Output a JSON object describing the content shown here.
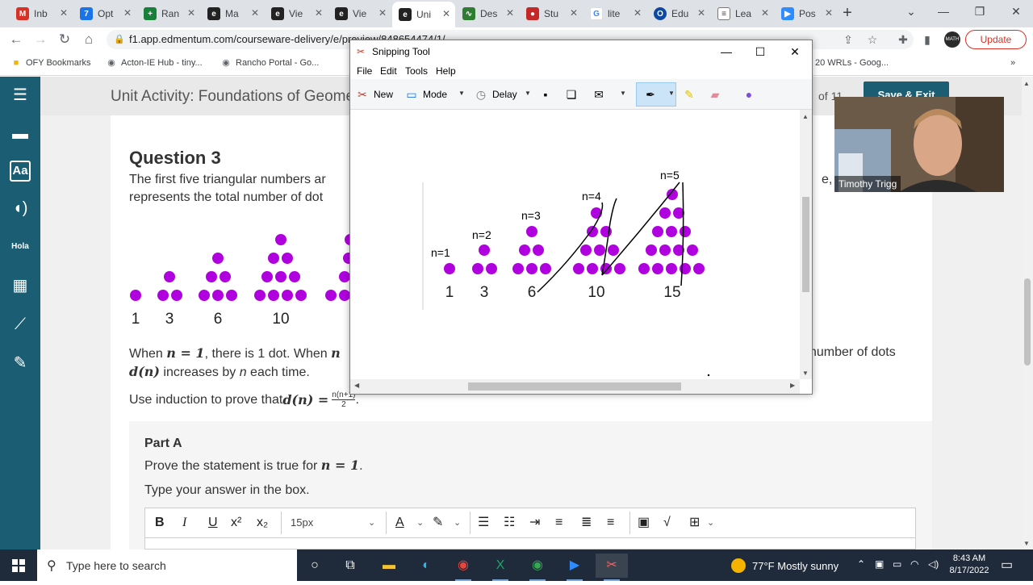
{
  "browser": {
    "tabs": [
      {
        "label": "Inb",
        "icon": "gmail-icon",
        "color": "#d93025"
      },
      {
        "label": "Opt",
        "icon": "calendar-icon",
        "color": "#1a73e8"
      },
      {
        "label": "Ran",
        "icon": "sheets-icon",
        "color": "#188038"
      },
      {
        "label": "Ma",
        "icon": "edmentum-icon",
        "color": "#222222"
      },
      {
        "label": "Vie",
        "icon": "edmentum-icon",
        "color": "#222222"
      },
      {
        "label": "Vie",
        "icon": "edmentum-icon",
        "color": "#222222"
      },
      {
        "label": "Uni",
        "icon": "edmentum-icon",
        "color": "#222222"
      },
      {
        "label": "Des",
        "icon": "desmos-icon",
        "color": "#2e7d32"
      },
      {
        "label": "Stu",
        "icon": "apple-icon",
        "color": "#c62828"
      },
      {
        "label": "lite",
        "icon": "google-icon",
        "color": "#4285f4"
      },
      {
        "label": "Edu",
        "icon": "edu-icon",
        "color": "#0d47a1"
      },
      {
        "label": "Lea",
        "icon": "doc-icon",
        "color": "#3c4043"
      },
      {
        "label": "Pos",
        "icon": "zoom-icon",
        "color": "#2d8cff"
      }
    ],
    "url": "f1.app.edmentum.com/courseware-delivery/e/preview/848654474/1/",
    "update_label": "Update",
    "avatar_text": "MATH",
    "bookmarks": [
      "OFY Bookmarks",
      "Acton-IE Hub - tiny...",
      "Rancho Portal - Go...",
      "20 WRLs - Goog..."
    ]
  },
  "page": {
    "title": "Unit Activity: Foundations of Geome",
    "count": "of  11",
    "save_exit": "Save & Exit",
    "question_title": "Question 3",
    "intro_line1": "The first five triangular numbers ar",
    "intro_line1_right": "e, ar",
    "intro_line2": "represents the total number of dot",
    "dot_labels": [
      "1",
      "3",
      "6",
      "10"
    ],
    "when_text_a": "When ",
    "when_math_a": "n = 1",
    "when_text_b": ", there is 1 dot. When ",
    "when_math_b": "n",
    "when_right": "number of dots",
    "increase_math": "d(n)",
    "increase_text": " increases by ",
    "increase_n": "n",
    "increase_tail": " each time.",
    "induction_text": "Use induction to prove that ",
    "induction_math": "d(n) =",
    "fraction_num": "n(n+1)",
    "fraction_den": "2",
    "part_a_title": "Part A",
    "part_a_text": "Prove the statement is true for ",
    "part_a_math": "n = 1",
    "part_a_hint": "Type your answer in the box.",
    "editor": {
      "font_size": "15px",
      "buttons": [
        "B",
        "I",
        "U",
        "x²",
        "x₂"
      ]
    }
  },
  "snipping_tool": {
    "title": "Snipping Tool",
    "menu": [
      "File",
      "Edit",
      "Tools",
      "Help"
    ],
    "tools": {
      "new": "New",
      "mode": "Mode",
      "delay": "Delay"
    },
    "annotations": [
      "n=1",
      "n=2",
      "n=3",
      "n=4",
      "n=5"
    ],
    "numbers": [
      "1",
      "3",
      "6",
      "10",
      "15"
    ]
  },
  "webcam": {
    "name": "Timothy Trigg"
  },
  "taskbar": {
    "search_placeholder": "Type here to search",
    "weather_temp": "77°F",
    "weather_text": "Mostly sunny",
    "time": "8:43 AM",
    "date": "8/17/2022"
  },
  "colors": {
    "dot": "#b000e0",
    "rail": "#1b5e73",
    "taskbar": "#1f2b3a"
  }
}
